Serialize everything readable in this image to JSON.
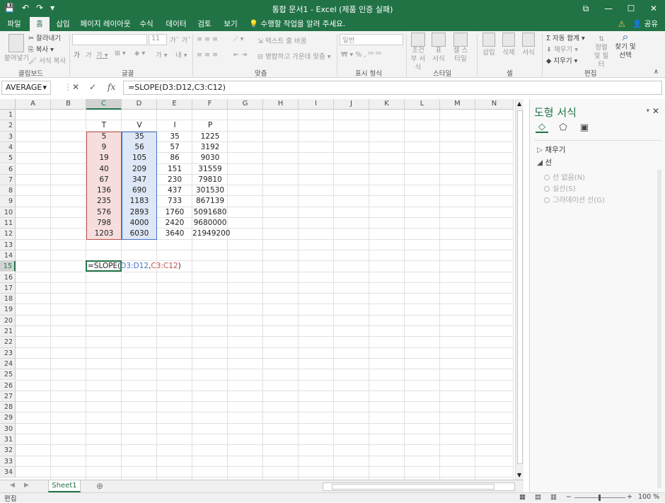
{
  "window": {
    "title": "통합 문서1 - Excel (제품 인증 실패)"
  },
  "qat": {
    "save_icon": "save-icon",
    "undo_icon": "undo-icon",
    "redo_icon": "redo-icon"
  },
  "tabs": [
    "파일",
    "홈",
    "삽입",
    "페이지 레이아웃",
    "수식",
    "데이터",
    "검토",
    "보기"
  ],
  "tell_me": "수행할 작업을 알려 주세요.",
  "share": "공유",
  "ribbon": {
    "clipboard": {
      "paste": "붙여넣기",
      "cut": "잘라내기",
      "copy": "복사",
      "format_painter": "서식 복사",
      "group": "클립보드"
    },
    "font": {
      "size": "11",
      "group": "글꼴"
    },
    "alignment": {
      "wrap": "텍스트 줄 바꿈",
      "merge": "병합하고 가운데 맞춤",
      "group": "맞춤"
    },
    "number": {
      "format": "일반",
      "group": "표시 형식"
    },
    "styles": {
      "conditional": "조건부 서식",
      "table": "표 서식",
      "cell": "셀 스타일",
      "group": "스타일"
    },
    "cells": {
      "insert": "삽입",
      "delete": "삭제",
      "format": "서식",
      "group": "셀"
    },
    "editing": {
      "autosum": "자동 합계",
      "fill": "채우기",
      "clear": "지우기",
      "sort": "정렬 및 필터",
      "find": "찾기 및 선택",
      "group": "편집"
    }
  },
  "formula_bar": {
    "name_box": "AVERAGE",
    "formula": "=SLOPE(D3:D12,C3:C12)"
  },
  "columns": [
    "A",
    "B",
    "C",
    "D",
    "E",
    "F",
    "G",
    "H",
    "I",
    "J",
    "K",
    "L",
    "M",
    "N"
  ],
  "rows": [
    "1",
    "2",
    "3",
    "4",
    "5",
    "6",
    "7",
    "8",
    "9",
    "10",
    "11",
    "12",
    "13",
    "14",
    "15",
    "16",
    "17",
    "18",
    "19",
    "20",
    "21",
    "22",
    "23",
    "24",
    "25",
    "26",
    "27",
    "28",
    "29",
    "30",
    "31",
    "32",
    "33",
    "34"
  ],
  "table": {
    "headers": [
      "T",
      "V",
      "I",
      "P"
    ],
    "data": [
      [
        "5",
        "35",
        "35",
        "1225"
      ],
      [
        "9",
        "56",
        "57",
        "3192"
      ],
      [
        "19",
        "105",
        "86",
        "9030"
      ],
      [
        "40",
        "209",
        "151",
        "31559"
      ],
      [
        "67",
        "347",
        "230",
        "79810"
      ],
      [
        "136",
        "690",
        "437",
        "301530"
      ],
      [
        "235",
        "1183",
        "733",
        "867139"
      ],
      [
        "576",
        "2893",
        "1760",
        "5091680"
      ],
      [
        "798",
        "4000",
        "2420",
        "9680000"
      ],
      [
        "1203",
        "6030",
        "3640",
        "21949200"
      ]
    ]
  },
  "editing_cell": {
    "prefix": "=SLOPE(",
    "arg1": "D3:D12",
    "comma": ",",
    "arg2": "C3:C12",
    "suffix": ")"
  },
  "sheet": {
    "tab": "Sheet1"
  },
  "status": {
    "mode": "편집",
    "zoom": "100 %"
  },
  "pane": {
    "title": "도형 서식",
    "fill": "채우기",
    "line": "선",
    "options": [
      "선 없음(N)",
      "실선(S)",
      "그라데이션 선(G)"
    ]
  },
  "colors": {
    "excel_green": "#217346",
    "range1": "#4472c4",
    "range2": "#c0504d"
  }
}
